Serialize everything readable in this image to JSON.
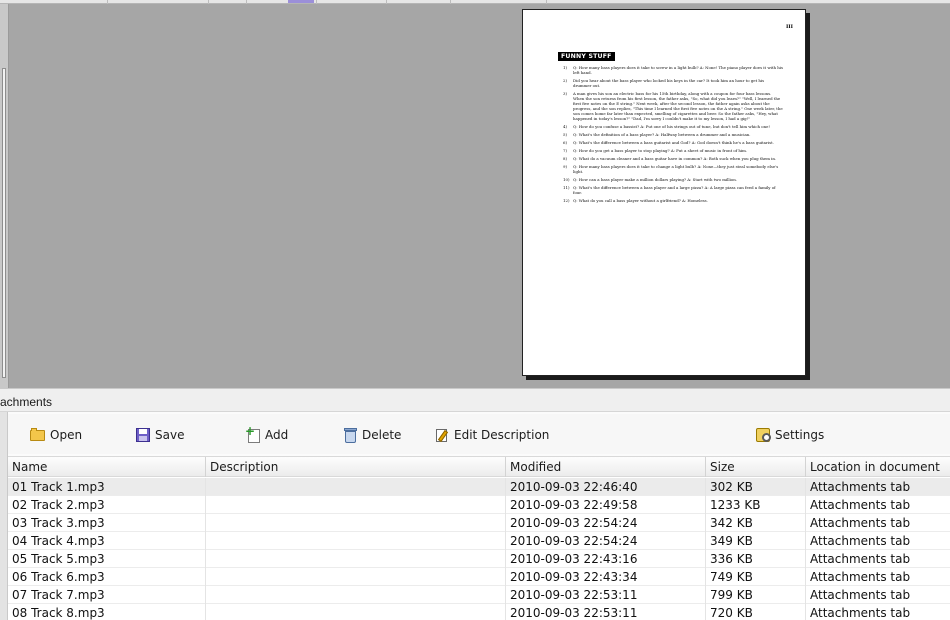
{
  "document": {
    "page_number": "III",
    "heading": "FUNNY STUFF",
    "jokes": [
      {
        "num": "1)",
        "text": "Q: How many bass players does it take to screw in a light bulb? A: None! The piano player does it with his left hand."
      },
      {
        "num": "2)",
        "text": "Did you hear about the bass player who locked his keys in the car? It took him an hour to get his drummer out."
      },
      {
        "num": "3)",
        "text": "A man gives his son an electric bass for his 15th birthday, along with a coupon for four bass lessons. When the son returns from his first lesson, the father asks, \"So, what did you learn?\" \"Well, I learned the first five notes on the E string.\" Next week, after the second lesson, the father again asks about the progress, and the son replies, \"This time I learned the first five notes on the A string.\" One week later, the son comes home far later than expected, smelling of cigarettes and beer. So the father asks, \"Hey, what happened in today's lesson?\" \"Dad, I'm sorry I couldn't make it to my lesson, I had a gig!\""
      },
      {
        "num": "4)",
        "text": "Q: How do you confuse a bassist? A: Put one of his strings out of tune, but don't tell him which one!"
      },
      {
        "num": "5)",
        "text": "Q: What's the definition of a bass player? A: Halfway between a drummer and a musician."
      },
      {
        "num": "6)",
        "text": "Q: What's the difference between a bass guitarist and God? A: God doesn't think he's a bass guitarist."
      },
      {
        "num": "7)",
        "text": "Q: How do you get a bass player to stop playing? A: Put a sheet of music in front of him."
      },
      {
        "num": "8)",
        "text": "Q: What do a vacuum cleaner and a bass guitar have in common? A: Both suck when you plug them in."
      },
      {
        "num": "9)",
        "text": "Q: How many bass players does it take to change a light bulb? A: None—they just steal somebody else's light."
      },
      {
        "num": "10)",
        "text": "Q: How can a bass player make a million dollars playing? A: Start with two million."
      },
      {
        "num": "11)",
        "text": "Q: What's the difference between a bass player and a large pizza? A: A large pizza can feed a family of four."
      },
      {
        "num": "12)",
        "text": "Q: What do you call a bass player without a girlfriend? A: Homeless."
      }
    ]
  },
  "panel": {
    "title": "achments"
  },
  "toolbar": {
    "open": "Open",
    "save": "Save",
    "add": "Add",
    "delete": "Delete",
    "edit_description": "Edit Description",
    "settings": "Settings"
  },
  "table": {
    "columns": [
      "Name",
      "Description",
      "Modified",
      "Size",
      "Location in document"
    ],
    "rows": [
      [
        "01 Track 1.mp3",
        "",
        "2010-09-03 22:46:40",
        "302 KB",
        "Attachments tab"
      ],
      [
        "02 Track 2.mp3",
        "",
        "2010-09-03 22:49:58",
        "1233 KB",
        "Attachments tab"
      ],
      [
        "03 Track 3.mp3",
        "",
        "2010-09-03 22:54:24",
        "342 KB",
        "Attachments tab"
      ],
      [
        "04 Track 4.mp3",
        "",
        "2010-09-03 22:54:24",
        "349 KB",
        "Attachments tab"
      ],
      [
        "05 Track 5.mp3",
        "",
        "2010-09-03 22:43:16",
        "336 KB",
        "Attachments tab"
      ],
      [
        "06 Track 6.mp3",
        "",
        "2010-09-03 22:43:34",
        "749 KB",
        "Attachments tab"
      ],
      [
        "07 Track 7.mp3",
        "",
        "2010-09-03 22:53:11",
        "799 KB",
        "Attachments tab"
      ],
      [
        "08 Track 8.mp3",
        "",
        "2010-09-03 22:53:11",
        "720 KB",
        "Attachments tab"
      ]
    ]
  }
}
